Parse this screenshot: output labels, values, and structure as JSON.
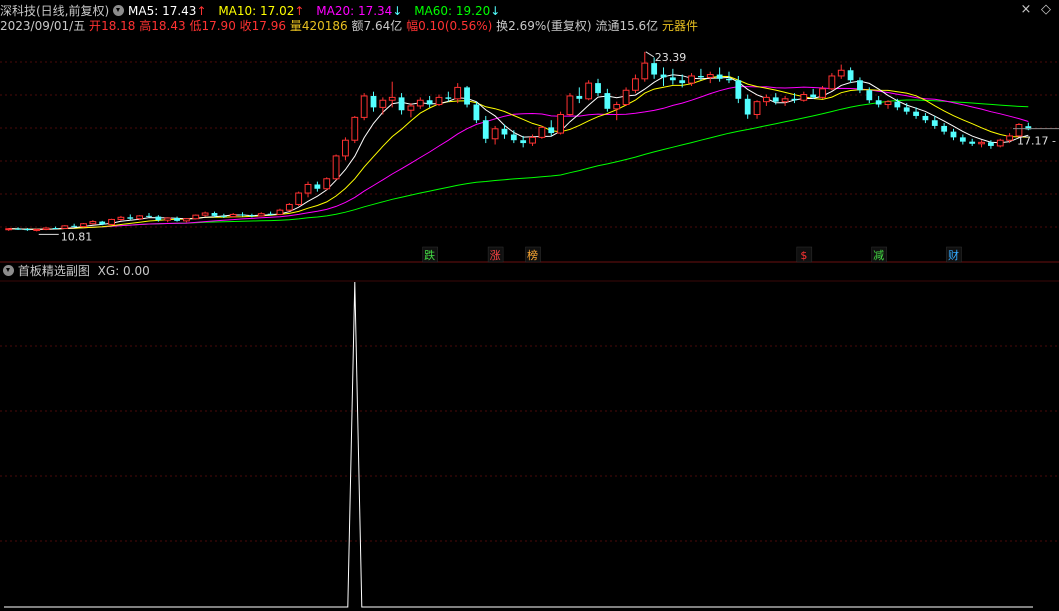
{
  "colors": {
    "bg": "#000000",
    "grid": "#4a0a0a",
    "up": "#ff3232",
    "down": "#54ffff",
    "ma5": "#ffffff",
    "ma10": "#ffff00",
    "ma20": "#ff00ff",
    "ma60": "#00ff00",
    "text": "#c8c8c8",
    "amber": "#e8c020"
  },
  "header": {
    "stock_title": "深科技(日线,前复权)",
    "ma5_label": "MA5: 17.43",
    "ma5_arrow": "↑",
    "ma10_label": "MA10: 17.02",
    "ma10_arrow": "↑",
    "ma20_label": "MA20: 17.34",
    "ma20_arrow": "↓",
    "ma60_label": "MA60: 19.20",
    "ma60_arrow": "↓"
  },
  "quote": {
    "date": "2023/09/01/五",
    "open_label": "开",
    "open": "18.18",
    "high_label": "高",
    "high": "18.43",
    "low_label": "低",
    "low": "17.90",
    "close_label": "收",
    "close": "17.96",
    "vol_label": "量",
    "vol": "420186",
    "amount": "额7.64亿",
    "range_label": "幅",
    "range": "0.10(0.56%)",
    "turnover": "换2.69%(重复权)",
    "float_cap": "流通15.6亿",
    "sector": "元器件"
  },
  "window_buttons": {
    "close": "×",
    "prev": "◇"
  },
  "subchart": {
    "title": "首板精选副图",
    "label": "XG: 0.00"
  },
  "chart_data": [
    {
      "type": "candlestick",
      "title": "深科技(日线,前复权)",
      "price_range": [
        10.0,
        24.5
      ],
      "annotations": {
        "high": "23.39",
        "low": "10.81",
        "last": "17.17"
      },
      "events": [
        {
          "index": 45,
          "label": "跌",
          "color": "#44dd44"
        },
        {
          "index": 52,
          "label": "涨",
          "color": "#ff4444"
        },
        {
          "index": 56,
          "label": "榜",
          "color": "#ffaa33"
        },
        {
          "index": 85,
          "label": "$",
          "color": "#ff3333"
        },
        {
          "index": 93,
          "label": "减",
          "color": "#44dd44"
        },
        {
          "index": 101,
          "label": "财",
          "color": "#33aaff"
        }
      ],
      "candles": [
        [
          10.95,
          11.05,
          10.85,
          11.0
        ],
        [
          11.0,
          11.1,
          10.92,
          10.98
        ],
        [
          10.98,
          11.05,
          10.85,
          10.9
        ],
        [
          10.9,
          11.0,
          10.81,
          10.95
        ],
        [
          10.95,
          11.1,
          10.9,
          11.05
        ],
        [
          11.05,
          11.15,
          10.98,
          11.02
        ],
        [
          11.02,
          11.25,
          11.0,
          11.2
        ],
        [
          11.2,
          11.35,
          11.1,
          11.15
        ],
        [
          11.15,
          11.4,
          11.1,
          11.35
        ],
        [
          11.35,
          11.6,
          11.3,
          11.5
        ],
        [
          11.5,
          11.55,
          11.25,
          11.3
        ],
        [
          11.3,
          11.7,
          11.25,
          11.65
        ],
        [
          11.65,
          11.9,
          11.55,
          11.8
        ],
        [
          11.8,
          12.0,
          11.6,
          11.7
        ],
        [
          11.7,
          11.95,
          11.6,
          11.9
        ],
        [
          11.9,
          12.1,
          11.8,
          11.85
        ],
        [
          11.85,
          11.95,
          11.5,
          11.6
        ],
        [
          11.6,
          11.8,
          11.45,
          11.75
        ],
        [
          11.75,
          11.85,
          11.5,
          11.55
        ],
        [
          11.55,
          11.75,
          11.45,
          11.7
        ],
        [
          11.7,
          12.0,
          11.65,
          11.95
        ],
        [
          11.95,
          12.2,
          11.85,
          12.1
        ],
        [
          12.1,
          12.2,
          11.8,
          11.9
        ],
        [
          11.9,
          12.05,
          11.75,
          11.85
        ],
        [
          11.85,
          12.1,
          11.8,
          12.0
        ],
        [
          12.0,
          12.15,
          11.85,
          11.95
        ],
        [
          11.95,
          12.05,
          11.8,
          11.9
        ],
        [
          11.9,
          12.15,
          11.85,
          12.05
        ],
        [
          12.05,
          12.2,
          11.95,
          12.0
        ],
        [
          12.0,
          12.4,
          11.95,
          12.3
        ],
        [
          12.3,
          12.8,
          12.2,
          12.7
        ],
        [
          12.7,
          13.6,
          12.6,
          13.5
        ],
        [
          13.5,
          14.3,
          13.2,
          14.1
        ],
        [
          14.1,
          14.3,
          13.6,
          13.8
        ],
        [
          13.8,
          14.6,
          13.7,
          14.5
        ],
        [
          14.5,
          16.2,
          14.4,
          16.1
        ],
        [
          16.1,
          17.4,
          15.8,
          17.2
        ],
        [
          17.2,
          18.9,
          17.0,
          18.8
        ],
        [
          18.8,
          20.5,
          18.6,
          20.3
        ],
        [
          20.3,
          20.6,
          19.2,
          19.5
        ],
        [
          19.5,
          20.2,
          19.0,
          20.0
        ],
        [
          20.0,
          21.3,
          19.5,
          20.2
        ],
        [
          20.2,
          20.5,
          19.0,
          19.3
        ],
        [
          19.3,
          19.8,
          18.8,
          19.6
        ],
        [
          19.6,
          20.2,
          19.4,
          20.0
        ],
        [
          20.0,
          20.3,
          19.5,
          19.7
        ],
        [
          19.7,
          20.4,
          19.6,
          20.2
        ],
        [
          20.2,
          20.6,
          19.9,
          20.1
        ],
        [
          20.1,
          21.2,
          19.8,
          20.9
        ],
        [
          20.9,
          21.0,
          19.5,
          19.7
        ],
        [
          19.7,
          19.9,
          18.4,
          18.6
        ],
        [
          18.6,
          18.9,
          17.0,
          17.3
        ],
        [
          17.3,
          18.2,
          16.9,
          18.0
        ],
        [
          18.0,
          18.3,
          17.3,
          17.6
        ],
        [
          17.6,
          17.9,
          17.0,
          17.2
        ],
        [
          17.2,
          17.5,
          16.7,
          17.0
        ],
        [
          17.0,
          17.6,
          16.8,
          17.4
        ],
        [
          17.4,
          18.2,
          17.3,
          18.1
        ],
        [
          18.1,
          18.6,
          17.5,
          17.7
        ],
        [
          17.7,
          19.2,
          17.6,
          19.0
        ],
        [
          19.0,
          20.5,
          18.9,
          20.3
        ],
        [
          20.3,
          20.9,
          19.8,
          20.1
        ],
        [
          20.1,
          21.4,
          20.0,
          21.2
        ],
        [
          21.2,
          21.5,
          20.3,
          20.5
        ],
        [
          20.5,
          20.8,
          19.2,
          19.4
        ],
        [
          19.4,
          19.9,
          18.6,
          19.7
        ],
        [
          19.7,
          20.9,
          19.6,
          20.7
        ],
        [
          20.7,
          21.8,
          20.5,
          21.5
        ],
        [
          21.5,
          23.39,
          21.3,
          22.6
        ],
        [
          22.6,
          23.0,
          21.5,
          21.8
        ],
        [
          21.8,
          22.3,
          21.0,
          21.6
        ],
        [
          21.6,
          22.2,
          21.1,
          21.4
        ],
        [
          21.4,
          21.8,
          20.9,
          21.2
        ],
        [
          21.2,
          21.9,
          21.0,
          21.7
        ],
        [
          21.7,
          22.2,
          21.4,
          21.6
        ],
        [
          21.6,
          22.0,
          21.2,
          21.8
        ],
        [
          21.8,
          22.3,
          21.3,
          21.5
        ],
        [
          21.5,
          22.0,
          21.2,
          21.4
        ],
        [
          21.4,
          21.7,
          19.8,
          20.1
        ],
        [
          20.1,
          20.4,
          18.7,
          19.0
        ],
        [
          19.0,
          20.0,
          18.7,
          19.9
        ],
        [
          19.9,
          20.4,
          19.6,
          20.2
        ],
        [
          20.2,
          20.5,
          19.7,
          19.9
        ],
        [
          19.9,
          20.3,
          19.6,
          20.1
        ],
        [
          20.1,
          20.5,
          19.8,
          20.0
        ],
        [
          20.0,
          20.6,
          19.9,
          20.4
        ],
        [
          20.4,
          20.8,
          20.1,
          20.2
        ],
        [
          20.2,
          21.0,
          20.1,
          20.8
        ],
        [
          20.8,
          21.9,
          20.7,
          21.7
        ],
        [
          21.7,
          22.5,
          21.5,
          22.1
        ],
        [
          22.1,
          22.3,
          21.2,
          21.4
        ],
        [
          21.4,
          21.6,
          20.5,
          20.7
        ],
        [
          20.7,
          20.9,
          19.8,
          20.0
        ],
        [
          20.0,
          20.3,
          19.5,
          19.7
        ],
        [
          19.7,
          20.0,
          19.4,
          19.9
        ],
        [
          19.9,
          20.1,
          19.3,
          19.5
        ],
        [
          19.5,
          19.8,
          19.0,
          19.2
        ],
        [
          19.2,
          19.5,
          18.7,
          18.9
        ],
        [
          18.9,
          19.1,
          18.4,
          18.6
        ],
        [
          18.6,
          18.9,
          18.0,
          18.2
        ],
        [
          18.2,
          18.4,
          17.6,
          17.8
        ],
        [
          17.8,
          18.0,
          17.2,
          17.4
        ],
        [
          17.4,
          17.6,
          16.9,
          17.1
        ],
        [
          17.1,
          17.3,
          16.8,
          16.95
        ],
        [
          16.95,
          17.2,
          16.7,
          17.05
        ],
        [
          17.05,
          17.2,
          16.6,
          16.8
        ],
        [
          16.8,
          17.3,
          16.7,
          17.2
        ],
        [
          17.2,
          17.7,
          17.0,
          17.5
        ],
        [
          17.5,
          18.4,
          17.4,
          18.3
        ],
        [
          18.18,
          18.43,
          17.9,
          17.96
        ]
      ]
    },
    {
      "type": "line",
      "title": "首板精选副图",
      "ylim": [
        0,
        1
      ],
      "series": [
        {
          "name": "XG",
          "spike_index": 37,
          "spike_value": 1,
          "other_value": 0
        }
      ]
    }
  ]
}
